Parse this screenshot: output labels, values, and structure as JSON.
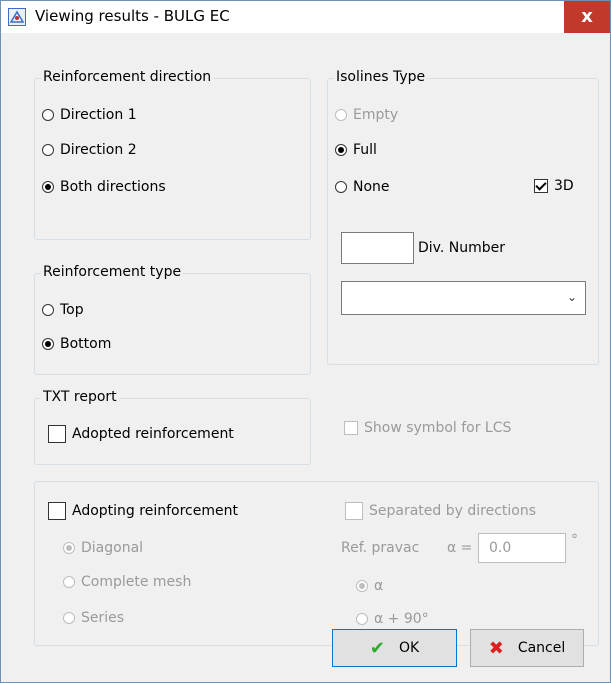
{
  "window": {
    "title": "Viewing results - BULG EC",
    "close_glyph": "x"
  },
  "reinforcement_direction": {
    "legend": "Reinforcement direction",
    "options": [
      {
        "label": "Direction 1",
        "checked": false
      },
      {
        "label": "Direction 2",
        "checked": false
      },
      {
        "label": "Both directions",
        "checked": true
      }
    ]
  },
  "reinforcement_type": {
    "legend": "Reinforcement type",
    "options": [
      {
        "label": "Top",
        "checked": false
      },
      {
        "label": "Bottom",
        "checked": true
      }
    ]
  },
  "isolines": {
    "legend": "Isolines Type",
    "options": [
      {
        "label": "Empty",
        "checked": false,
        "disabled": true
      },
      {
        "label": "Full",
        "checked": true,
        "disabled": false
      },
      {
        "label": "None",
        "checked": false,
        "disabled": false
      }
    ],
    "three_d_label": "3D",
    "three_d_checked": true,
    "div_number_label": "Div. Number",
    "div_number_value": "",
    "dropdown_value": ""
  },
  "txt_report": {
    "legend": "TXT report",
    "adopted_label": "Adopted reinforcement",
    "adopted_checked": false
  },
  "show_symbol_lcs": {
    "label": "Show symbol for LCS",
    "checked": false,
    "disabled": true
  },
  "adopting": {
    "label": "Adopting reinforcement",
    "checked": false,
    "options": [
      {
        "label": "Diagonal",
        "checked": true
      },
      {
        "label": "Complete mesh",
        "checked": false
      },
      {
        "label": "Series",
        "checked": false
      }
    ],
    "separated_label": "Separated by directions",
    "ref_label": "Ref. pravac",
    "alpha_eq_label": "α =",
    "alpha_value": "0.0",
    "degree_symbol": "°",
    "alpha_options": [
      {
        "label": "α",
        "checked": true
      },
      {
        "label": "α + 90°",
        "checked": false
      }
    ]
  },
  "buttons": {
    "ok_label": "OK",
    "cancel_label": "Cancel",
    "ok_icon_color": "#2eaa2e",
    "cancel_icon_color": "#d92020"
  }
}
